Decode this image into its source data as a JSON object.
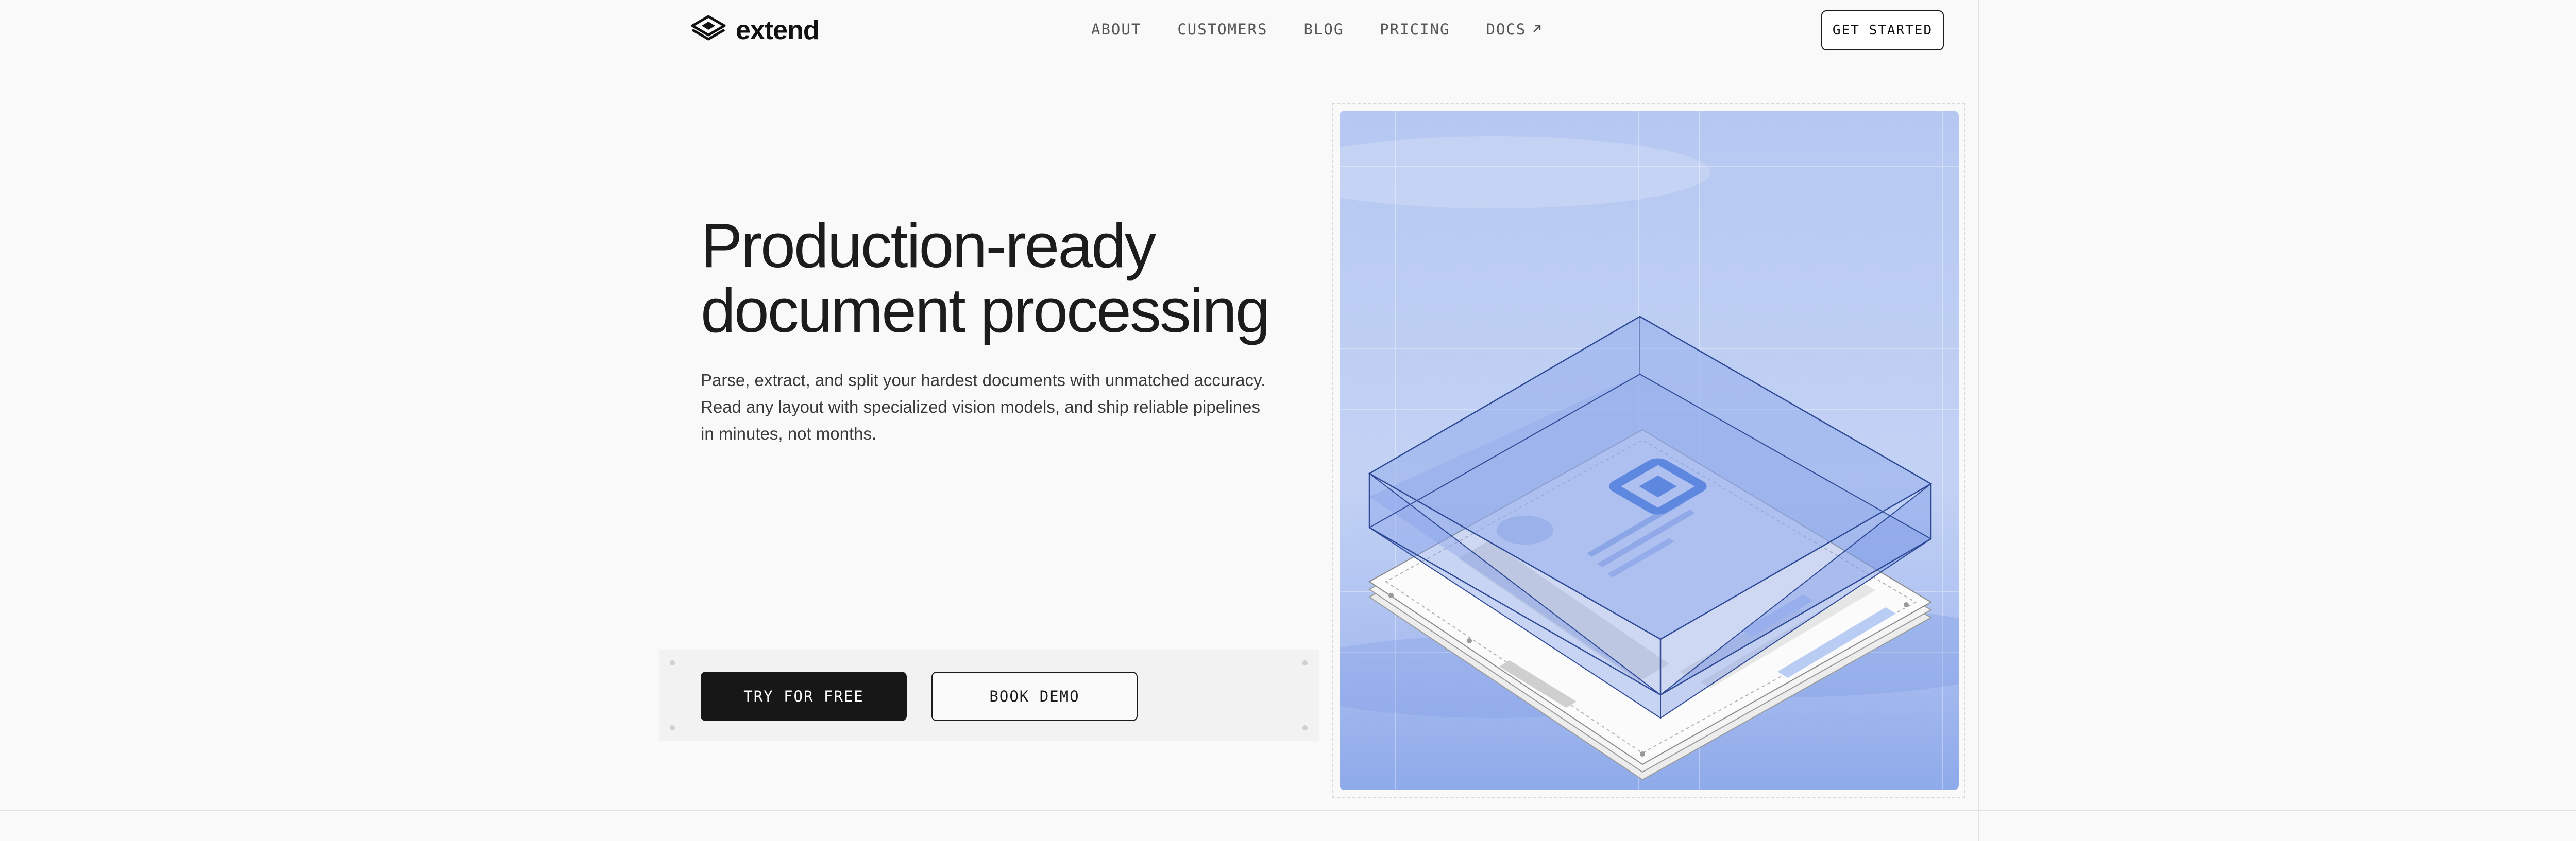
{
  "brand": {
    "name": "extend",
    "logo_icon": "layered-diamond-logo"
  },
  "nav": {
    "items": [
      {
        "label": "ABOUT"
      },
      {
        "label": "CUSTOMERS"
      },
      {
        "label": "BLOG"
      },
      {
        "label": "PRICING"
      },
      {
        "label": "DOCS",
        "icon": "arrow-up-right-icon"
      }
    ],
    "cta_label": "GET STARTED"
  },
  "hero": {
    "title_line1": "Production-ready",
    "title_line2": "document processing",
    "subtitle": "Parse, extract, and split your hardest documents with unmatched accuracy. Read any layout with specialized vision models, and ship reliable pipelines in minutes, not months.",
    "primary_cta": "TRY FOR FREE",
    "secondary_cta": "BOOK DEMO"
  },
  "colors": {
    "accent_blue": "#8faaf0",
    "dark_button": "#171717",
    "page_bg": "#f9f9f9"
  }
}
